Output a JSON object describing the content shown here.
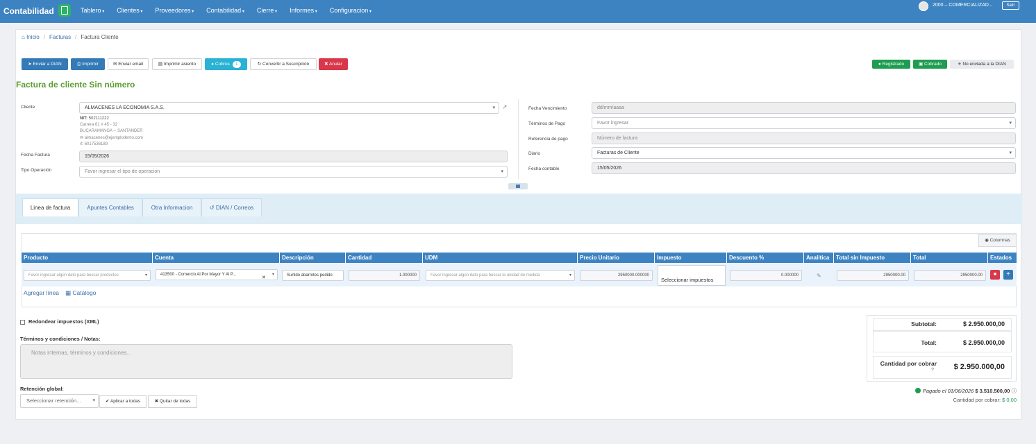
{
  "topnav": {
    "brand": "Contabilidad",
    "menu": [
      "Tablero",
      "Clientes",
      "Proveedores",
      "Contabilidad",
      "Cierre",
      "Informes",
      "Configuracion"
    ],
    "user": "2000 – COMERCIALIZAD...",
    "logout": "Salir"
  },
  "breadcrumb": [
    "Inicio",
    "Facturas",
    "Factura Cliente"
  ],
  "toolbar": {
    "send_dian": "Enviar a DIAN",
    "print": "Imprimir",
    "email": "Enviar email",
    "print_entry": "Imprimir asiento",
    "payments": "Cobros",
    "payments_count": "1",
    "convert": "Convertir a Suscripción",
    "cancel": "Anular"
  },
  "status": {
    "registered": "Registrado",
    "paid": "Cobrado",
    "dian": "No enviada a la DIAN"
  },
  "title": "Factura de cliente Sin número",
  "form": {
    "client_label": "Cliente",
    "client_value": "ALMACENES LA ECONOMIA S.A.S.",
    "client_nit_label": "NIT:",
    "client_nit": "502111222",
    "client_address": "Carrera 61 # 45 - 32",
    "client_city": "BUCARAMANGA -- SANTANDER",
    "client_email": "almacenes@ejemplodemo.com",
    "client_phone": "6017536189",
    "invoice_date_label": "Fecha Factura",
    "invoice_date": "15/05/2026",
    "operation_label": "Tipo Operación",
    "operation_placeholder": "Favor ingresar el tipo de operacion",
    "due_label": "Fecha Vencimiento",
    "due_placeholder": "dd/mm/aaaa",
    "terms_label": "Términos de Pago",
    "terms_placeholder": "Favor ingresar",
    "payref_label": "Referencia de pago",
    "payref_placeholder": "Número de factura",
    "journal_label": "Diario",
    "journal_value": "Facturas de Cliente",
    "accounting_date_label": "Fecha contable",
    "accounting_date": "15/05/2026"
  },
  "tabs": [
    "Linea de factura",
    "Apuntes Contables",
    "Otra Informacion",
    "DIAN / Correos"
  ],
  "grid": {
    "columns_btn": "Columnas",
    "headers": [
      "Producto",
      "Cuenta",
      "Descripción",
      "Cantidad",
      "UDM",
      "Precio Unitario",
      "Impuesto",
      "Descuento %",
      "Analitica",
      "Total sin Impuesto",
      "Total",
      "Estados"
    ],
    "row": {
      "product_placeholder": "Favor ingresar algún dato para buscar productos",
      "account": "413500 - Comercio Al Por Mayor Y Al P...",
      "description": "Surtido abarrotes pedido",
      "quantity": "1.000000",
      "udm_placeholder": "Favor ingresar algún dato para buscar la unidad de medida",
      "unit_price": "2950000.000000",
      "tax_placeholder": "Seleccionar impuestos",
      "discount": "0.000000",
      "subtotal": "2950000.00",
      "total": "2950000.00"
    },
    "add_line": "Agregar línea",
    "catalog": "Catálogo"
  },
  "footer": {
    "round_taxes": "Redondear impuestos (XML)",
    "notes_label": "Términos y condiciones / Notas:",
    "notes_placeholder": "Notas internas, términos y condiciones...",
    "retention_label": "Retención global:",
    "retention_placeholder": "Seleccionar retención...",
    "apply_all": "Aplicar a todas",
    "remove_all": "Quitar de todas"
  },
  "totals": {
    "subtotal_label": "Subtotal:",
    "subtotal": "$ 2.950.000,00",
    "total_label": "Total:",
    "total": "$ 2.950.000,00",
    "receivable_label": "Cantidad por cobrar",
    "receivable": "$ 2.950.000,00",
    "paid_text": "Pagado el 01/06/2026",
    "paid_amount": "$ 3.510.500,00",
    "pending_label": "Cantidad por cobrar:",
    "pending_value": "$ 0,00"
  }
}
